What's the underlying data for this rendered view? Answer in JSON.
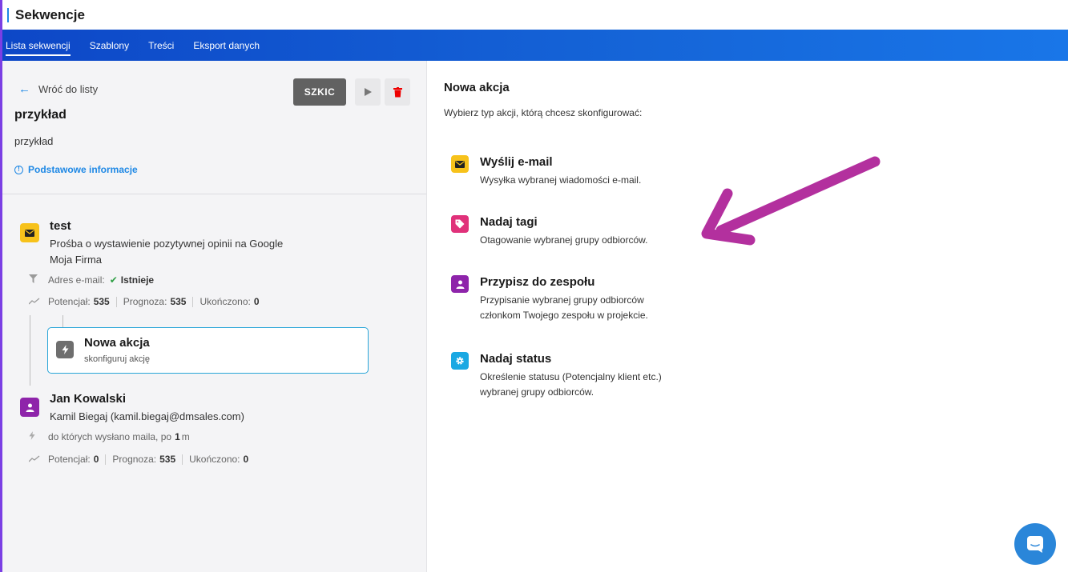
{
  "app": {
    "title": "Sekwencje"
  },
  "nav": {
    "tabs": [
      {
        "label": "Lista sekwencji",
        "active": true
      },
      {
        "label": "Szablony",
        "active": false
      },
      {
        "label": "Treści",
        "active": false
      },
      {
        "label": "Eksport danych",
        "active": false
      }
    ]
  },
  "sequence": {
    "back_label": "Wróć do listy",
    "status_label": "SZKIC",
    "name": "przykład",
    "description": "przykład",
    "basic_info_label": "Podstawowe informacje",
    "steps": [
      {
        "icon": "envelope-icon",
        "title": "test",
        "line1": "Prośba o wystawienie pozytywnej opinii na Google",
        "line2": "Moja Firma",
        "filter_label": "Adres e-mail:",
        "filter_value": "Istnieje",
        "potential_label": "Potencjał:",
        "potential_value": "535",
        "forecast_label": "Prognoza:",
        "forecast_value": "535",
        "completed_label": "Ukończono:",
        "completed_value": "0"
      },
      {
        "icon": "person-icon",
        "title": "Jan Kowalski",
        "line1": "Kamil Biegaj (kamil.biegaj@dmsales.com)",
        "trigger_label": "do których wysłano maila, po",
        "trigger_value": "1",
        "trigger_unit": "m",
        "potential_label": "Potencjał:",
        "potential_value": "0",
        "forecast_label": "Prognoza:",
        "forecast_value": "535",
        "completed_label": "Ukończono:",
        "completed_value": "0"
      }
    ],
    "new_action": {
      "title": "Nowa akcja",
      "subtitle": "skonfiguruj akcję"
    }
  },
  "right_panel": {
    "title": "Nowa akcja",
    "subtitle": "Wybierz typ akcji, którą chcesz skonfigurować:",
    "options": [
      {
        "icon": "envelope-icon",
        "color": "#f7c21b",
        "title": "Wyślij e-mail",
        "desc1": "Wysyłka wybranej wiadomości e-mail.",
        "desc2": ""
      },
      {
        "icon": "tag-icon",
        "color": "#e0317a",
        "title": "Nadaj tagi",
        "desc1": "Otagowanie wybranej grupy odbiorców.",
        "desc2": ""
      },
      {
        "icon": "person-icon",
        "color": "#8e24aa",
        "title": "Przypisz do zespołu",
        "desc1": "Przypisanie wybranej grupy odbiorców",
        "desc2": "członkom Twojego zespołu w projekcie."
      },
      {
        "icon": "gear-icon",
        "color": "#19a8e3",
        "title": "Nadaj status",
        "desc1": "Określenie statusu (Potencjalny klient etc.)",
        "desc2": "wybranej grupy odbiorców."
      }
    ]
  },
  "colors": {
    "accent": "#1e88e5",
    "nav_gradient_start": "#0d47c7",
    "annotation_arrow": "#b3309e",
    "status_ok": "#2e9e44"
  }
}
